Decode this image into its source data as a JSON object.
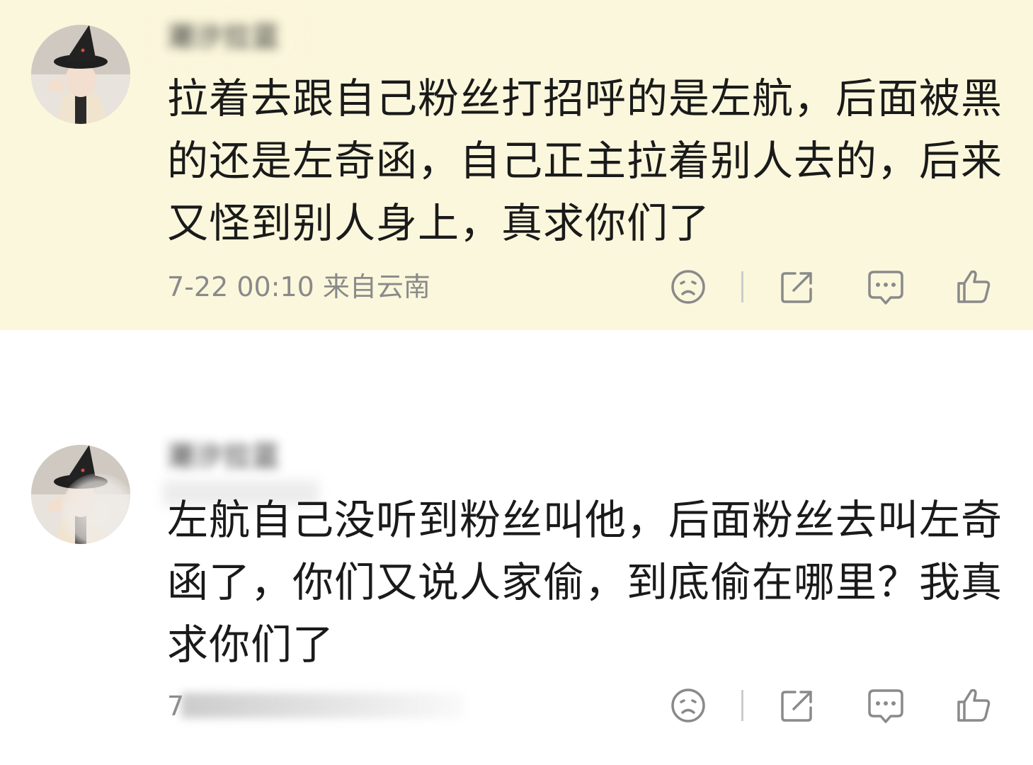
{
  "comments": [
    {
      "username": "潮汐拉蓝",
      "text": "拉着去跟自己粉丝打招呼的是左航，后面被黑的还是左奇函，自己正主拉着别人去的，后来又怪到别人身上，真求你们了",
      "meta": "7-22 00:10 来自云南",
      "avatar_icon": "avatar-witch-hat-icon"
    },
    {
      "username": "潮汐拉蓝",
      "text": "左航自己没听到粉丝叫他，后面粉丝去叫左奇函了，你们又说人家偷，到底偷在哪里？我真求你们了",
      "meta": "7",
      "avatar_icon": "avatar-witch-hat-icon"
    }
  ],
  "actions": {
    "dislike_icon": "dislike-face-icon",
    "share_icon": "share-icon",
    "comment_icon": "comment-bubble-icon",
    "like_icon": "thumbs-up-icon"
  },
  "colors": {
    "highlight_background": "#fbf7dc",
    "text": "#1a1a1a",
    "meta_text": "#8a8a8a",
    "icon": "#8a8a8a"
  }
}
